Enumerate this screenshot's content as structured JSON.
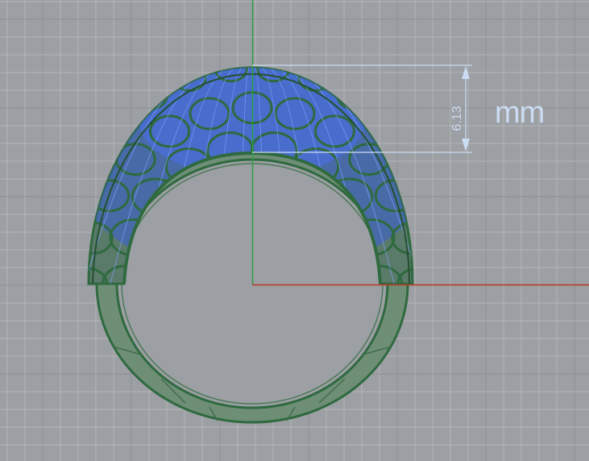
{
  "viewport": {
    "name": "top-view",
    "dimension": {
      "value": "6.13",
      "units": "mm"
    }
  },
  "colors": {
    "background": "#9c9fa3",
    "grid_minor": "#b3b6ba",
    "grid_major": "#8c8f93",
    "axis_x": "#c0392b",
    "axis_y": "#2ea043",
    "ring_body": "#5b7d63",
    "ring_edge": "#2f6a3f",
    "wire_blue": "#3a5fd9",
    "annotation": "#ccdcf2"
  }
}
